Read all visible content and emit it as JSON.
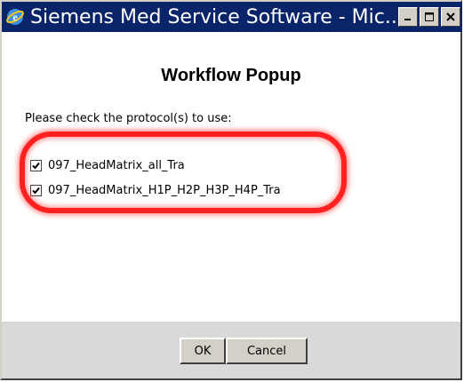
{
  "window": {
    "title": "Siemens Med Service Software - Mic..."
  },
  "popup": {
    "title": "Workflow Popup",
    "prompt": "Please check the protocol(s) to use:",
    "protocols": [
      {
        "label": "097_HeadMatrix_all_Tra",
        "checked": true
      },
      {
        "label": "097_HeadMatrix_H1P_H2P_H3P_H4P_Tra",
        "checked": true
      }
    ]
  },
  "buttons": {
    "ok": "OK",
    "cancel": "Cancel"
  },
  "colors": {
    "titlebar": "#0a246a",
    "highlight": "#ff2020",
    "footer": "#d9d9d9"
  }
}
